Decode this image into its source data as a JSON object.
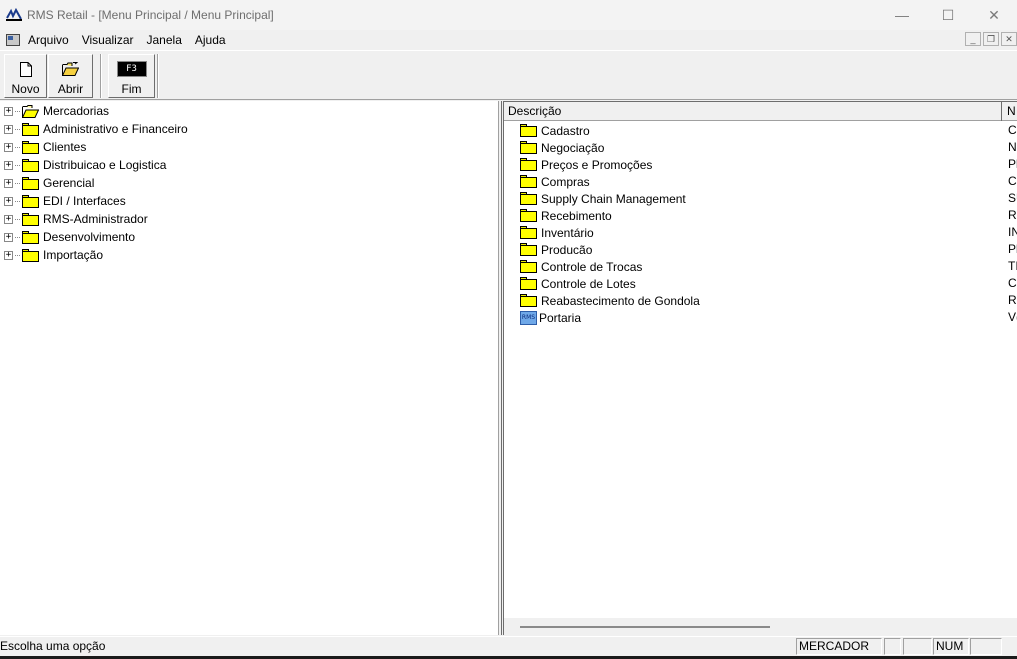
{
  "window": {
    "title": "RMS Retail - [Menu Principal / Menu Principal]",
    "controls": {
      "minimize": "—",
      "maximize": "☐",
      "close": "✕"
    }
  },
  "menubar": {
    "items": [
      "Arquivo",
      "Visualizar",
      "Janela",
      "Ajuda"
    ],
    "mdi_controls": {
      "minimize": "_",
      "restore": "❐",
      "close": "✕"
    }
  },
  "toolbar": {
    "buttons": [
      {
        "label": "Novo",
        "icon": "new-document-icon"
      },
      {
        "label": "Abrir",
        "icon": "open-folder-icon"
      },
      {
        "label": "Fim",
        "icon": "f3-key-icon",
        "key": "F3"
      }
    ]
  },
  "tree": {
    "expander": "+",
    "items": [
      {
        "label": "Mercadorias",
        "icon": "open-folder-icon"
      },
      {
        "label": "Administrativo e Financeiro",
        "icon": "folder-icon"
      },
      {
        "label": "Clientes",
        "icon": "folder-icon"
      },
      {
        "label": "Distribuicao e Logistica",
        "icon": "folder-icon"
      },
      {
        "label": "Gerencial",
        "icon": "folder-icon"
      },
      {
        "label": "EDI / Interfaces",
        "icon": "folder-icon"
      },
      {
        "label": "RMS-Administrador",
        "icon": "folder-icon"
      },
      {
        "label": "Desenvolvimento",
        "icon": "folder-icon"
      },
      {
        "label": "Importação",
        "icon": "folder-icon"
      }
    ]
  },
  "list": {
    "columns": [
      "Descrição",
      "N"
    ],
    "rows": [
      {
        "descricao": "Cadastro",
        "code": "C.",
        "icon": "folder-icon"
      },
      {
        "descricao": "Negociação",
        "code": "N",
        "icon": "folder-icon"
      },
      {
        "descricao": "Preços e Promoções",
        "code": "Pl",
        "icon": "folder-icon"
      },
      {
        "descricao": "Compras",
        "code": "C",
        "icon": "folder-icon"
      },
      {
        "descricao": "Supply Chain Management",
        "code": "SU",
        "icon": "folder-icon"
      },
      {
        "descricao": "Recebimento",
        "code": "RI",
        "icon": "folder-icon"
      },
      {
        "descricao": "Inventário",
        "code": "IN",
        "icon": "folder-icon"
      },
      {
        "descricao": "Producão",
        "code": "Pl",
        "icon": "folder-icon"
      },
      {
        "descricao": "Controle de Trocas",
        "code": "TI",
        "icon": "folder-icon"
      },
      {
        "descricao": "Controle de Lotes",
        "code": "C",
        "icon": "folder-icon"
      },
      {
        "descricao": "Reabastecimento de Gondola",
        "code": "RI",
        "icon": "folder-icon"
      },
      {
        "descricao": "Portaria",
        "code": "V(",
        "icon": "rms-program-icon",
        "icon_text": "RMS"
      }
    ]
  },
  "statusbar": {
    "message": "Escolha uma opção",
    "cells": [
      "MERCADOR",
      "",
      "",
      "NUM",
      ""
    ]
  }
}
